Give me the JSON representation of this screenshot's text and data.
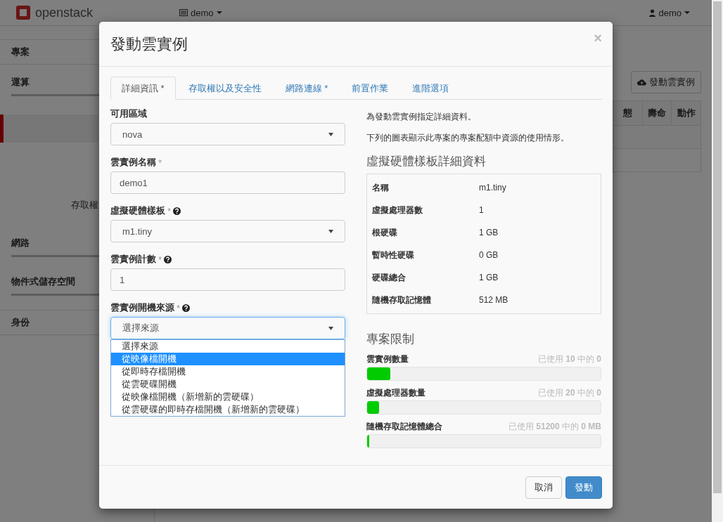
{
  "topbar": {
    "logo": "openstack",
    "project": "demo",
    "user": "demo"
  },
  "sidebar": {
    "items": [
      {
        "kind": "section",
        "label": "專案"
      },
      {
        "kind": "group",
        "label": "運算"
      },
      {
        "kind": "active"
      },
      {
        "kind": "link",
        "label": "存取權"
      },
      {
        "kind": "group",
        "label": "網路"
      },
      {
        "kind": "group",
        "label": "物件式儲存空間"
      },
      {
        "kind": "section",
        "label": "身份"
      }
    ]
  },
  "page": {
    "launch_button": "發動雲實例",
    "table": {
      "columns": [
        "態",
        "壽命",
        "動作"
      ]
    }
  },
  "modal": {
    "title": "發動雲實例",
    "close": "×",
    "tabs": [
      {
        "label": "詳細資訊 *",
        "selected": true
      },
      {
        "label": "存取權以及安全性",
        "selected": false
      },
      {
        "label": "網路連線 *",
        "selected": false
      },
      {
        "label": "前置作業",
        "selected": false
      },
      {
        "label": "進階選項",
        "selected": false
      }
    ],
    "fields": [
      {
        "label": "可用區域",
        "kind": "select",
        "value": "nova"
      },
      {
        "label": "雲實例名稱",
        "mark": "*",
        "kind": "input",
        "value": "demo1"
      },
      {
        "label": "虛擬硬體樣板",
        "mark": "*",
        "help": true,
        "kind": "select",
        "value": "m1.tiny"
      },
      {
        "label": "雲實例計數",
        "mark": "*",
        "help": true,
        "kind": "input",
        "value": "1"
      },
      {
        "label": "雲實例開機來源",
        "mark": "*",
        "help": true,
        "kind": "select",
        "value": "選擇來源",
        "open": true,
        "options": [
          {
            "label": "選擇來源",
            "highlighted": false
          },
          {
            "label": "從映像檔開機",
            "highlighted": true
          },
          {
            "label": "從即時存檔開機",
            "highlighted": false
          },
          {
            "label": "從雲硬碟開機",
            "highlighted": false
          },
          {
            "label": "從映像檔開機（新增新的雲硬碟）",
            "highlighted": false
          },
          {
            "label": "從雲硬碟的即時存檔開機（新增新的雲硬碟）",
            "highlighted": false
          }
        ]
      }
    ],
    "info": [
      "為發動雲實例指定詳細資料。",
      "下列的圖表顯示此專案的專案配額中資源的使用情形。"
    ],
    "flavor": {
      "title": "虛擬硬體樣板詳細資料",
      "rows": [
        {
          "name": "名稱",
          "value": "m1.tiny"
        },
        {
          "name": "虛擬處理器數",
          "value": "1"
        },
        {
          "name": "根硬碟",
          "value": "1 GB"
        },
        {
          "name": "暫時性硬碟",
          "value": "0 GB"
        },
        {
          "name": "硬碟總合",
          "value": "1 GB"
        },
        {
          "name": "隨機存取記憶體",
          "value": "512 MB"
        }
      ]
    },
    "limits": {
      "title": "專案限制",
      "items": [
        {
          "label": "雲實例數量",
          "usage": "已使用 **10** 中的 **0**",
          "level": 0.1
        },
        {
          "label": "虛擬處理器數量",
          "usage": "已使用 **20** 中的 **0**",
          "level": 0.05
        },
        {
          "label": "隨機存取記憶體總合",
          "usage": "已使用 **51200** 中的 **0 MB**",
          "level": 0.01
        }
      ]
    },
    "buttons": [
      {
        "label": "取消",
        "kind": "default"
      },
      {
        "label": "發動",
        "kind": "primary"
      }
    ]
  }
}
